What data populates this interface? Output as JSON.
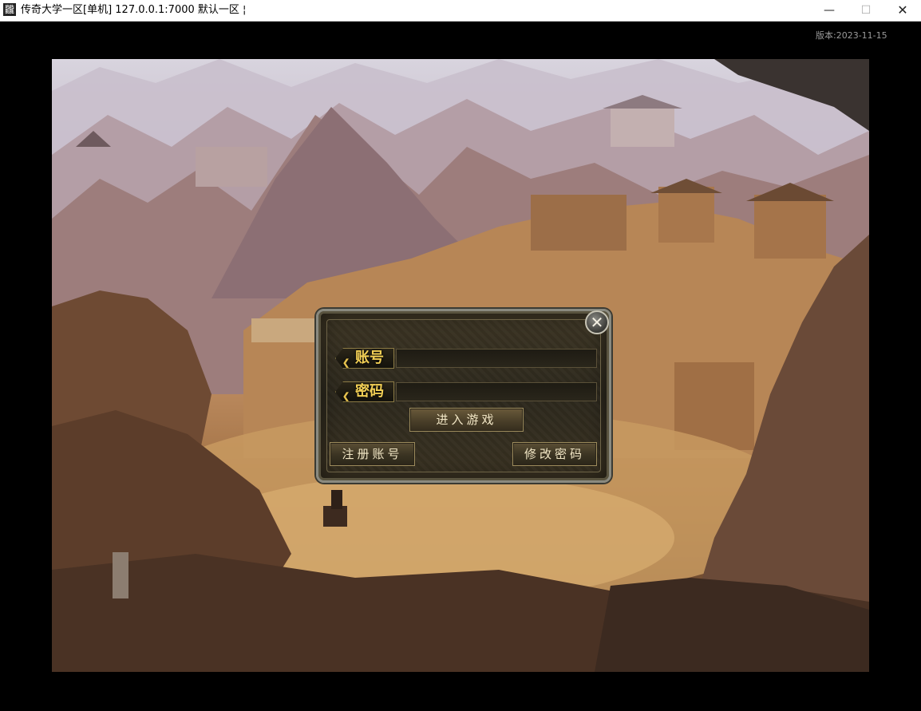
{
  "window": {
    "title": "传奇大学一区[单机] 127.0.0.1:7000  默认一区 ¦",
    "icon_glyph": "龖",
    "controls": {
      "minimize": "—",
      "maximize": "☐",
      "close": "✕"
    }
  },
  "version_label": "版本:2023-11-15",
  "login": {
    "account_label": "账号",
    "password_label": "密码",
    "account_value": "",
    "password_value": "",
    "enter_button": "进入游戏",
    "register_button": "注册账号",
    "change_password_button": "修改密码",
    "close_glyph": "✕"
  },
  "colors": {
    "label_gold": "#f2cf55",
    "button_text": "#f1e6c5",
    "panel_border": "#8a8a80"
  }
}
